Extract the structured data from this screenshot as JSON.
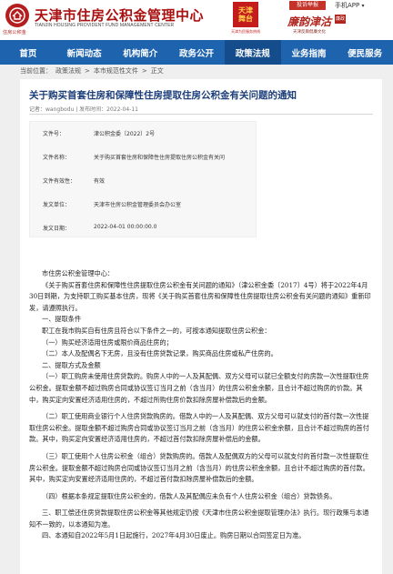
{
  "header": {
    "title": "天津市住房公积金管理中心",
    "subtitle": "TIANJIN HOUSING PROVIDENT FUND MANAGEMENT CENTER",
    "logo_caption": "住房公积金",
    "emblem_text": "天津 舞台",
    "emblem_caption": "天津为民服务热线",
    "slogan": "廉韵津沽",
    "slogan_tag": "廉政",
    "slogan_sub": "天津反腐倡廉文化",
    "top_link_red": "投诉举报",
    "top_link": "手机APP",
    "top_link_arrow": "▾",
    "brand_color": "#a91010"
  },
  "nav": {
    "items": [
      "首页",
      "新闻动态",
      "机构简介",
      "政务公开",
      "政策法规",
      "业务指南",
      "便民服务"
    ],
    "active_index": 4,
    "color": "#1e63ae"
  },
  "breadcrumb": {
    "prefix": "当前位置：",
    "items": [
      "政策法规",
      "本市规范性文件",
      "正文"
    ],
    "separator": ">"
  },
  "article": {
    "title": "关于购买首套住房和保障性住房提取住房公积金有关问题的通知",
    "meta": "记者：wangbodu  |  发布时间：2022-04-11",
    "doc_info": [
      {
        "label": "文件号：",
        "value": "津公积金委〔2022〕2号"
      },
      {
        "label": "文件名称：",
        "value": "关于购买首套住房和保障性住房提取住房公积金有关问"
      },
      {
        "label": "文件有效性：",
        "value": "有效"
      },
      {
        "label": "发文单位：",
        "value": "天津市住房公积金管理委员会办公室"
      },
      {
        "label": "发文日期：",
        "value": "2022-04-01 00:00:00.0"
      }
    ],
    "paragraphs": [
      {
        "cls": "ind",
        "text": "市住房公积金管理中心："
      },
      {
        "cls": "ind",
        "text": "《关于购买首套住房和保障性住房提取住房公积金有关问题的通知》（津公积金委〔2017〕4号）将于2022年4月30日到期，为支持职工购买基本住房，现将《关于购买首套住房和保障性住房提取住房公积金有关问题的通知》重新印发，请遵照执行。"
      },
      {
        "cls": "ind",
        "text": "一、提取条件"
      },
      {
        "cls": "ind",
        "text": "职工在我市购买自有住房且符合以下条件之一的，可按本通知提取住房公积金："
      },
      {
        "cls": "ind",
        "text": "（一）购买经济适用住房或限价商品住房的；"
      },
      {
        "cls": "ind",
        "text": "（二）本人及配偶名下无房，且没有住房贷款记录，购买商品住房或私产住房的。"
      },
      {
        "cls": "ind",
        "text": "二、提取方式及金额"
      },
      {
        "cls": "ind",
        "text": "（一）职工购房未使用住房贷款的。购房人中的一人及其配偶、双方父母可以就已全额支付的房款一次性提取住房公积金。提取金额不超过购房合同或协议签订当月之前（含当月）的住房公积金余额，且合计不超过购房的价款。其中，购买定向安置经济适用住房的，不超过所购住房价款扣除房屋补偿款后的金额。"
      },
      {
        "cls": "ind gap",
        "text": "（二）职工使用商业银行个人住房贷款购房的。借款人中的一人及其配偶、双方父母可以就支付的首付款一次性提取住房公积金。提取金额不超过购房合同或协议签订当月之前（含当月）的住房公积金余额，且合计不超过购房的首付款。其中，购买定向安置经济适用住房的，不超过首付款扣除房屋补偿后的金额。"
      },
      {
        "cls": "ind gap",
        "text": "（三）职工使用个人住房公积金（组合）贷款购房的。借款人及配偶双方的父母可以就支付的首付款一次性提取住房公积金。提取金额不超过购房合同或协议签订当月之前（含当月）的住房公积金余额，且合计不超过购房的首付款。其中，购买定向安置经济适用住房的，不超过首付款扣除房屋补偿款后的金额。"
      },
      {
        "cls": "ind gap",
        "text": "（四）根据本条规定提取住房公积金的，借款人及其配偶应未负有个人住房公积金（组合）贷款债务。"
      },
      {
        "cls": "ind gap",
        "text": "三、职工偿还住房贷款提取住房公积金等其他规定仍按《天津市住房公积金提取管理办法》执行。现行政策与本通知不一致的，以本通知为准。"
      },
      {
        "cls": "ind",
        "text": "四、本通知自2022年5月1日起施行，2027年4月30日废止。购房日期以合同签定日为准。"
      }
    ]
  }
}
